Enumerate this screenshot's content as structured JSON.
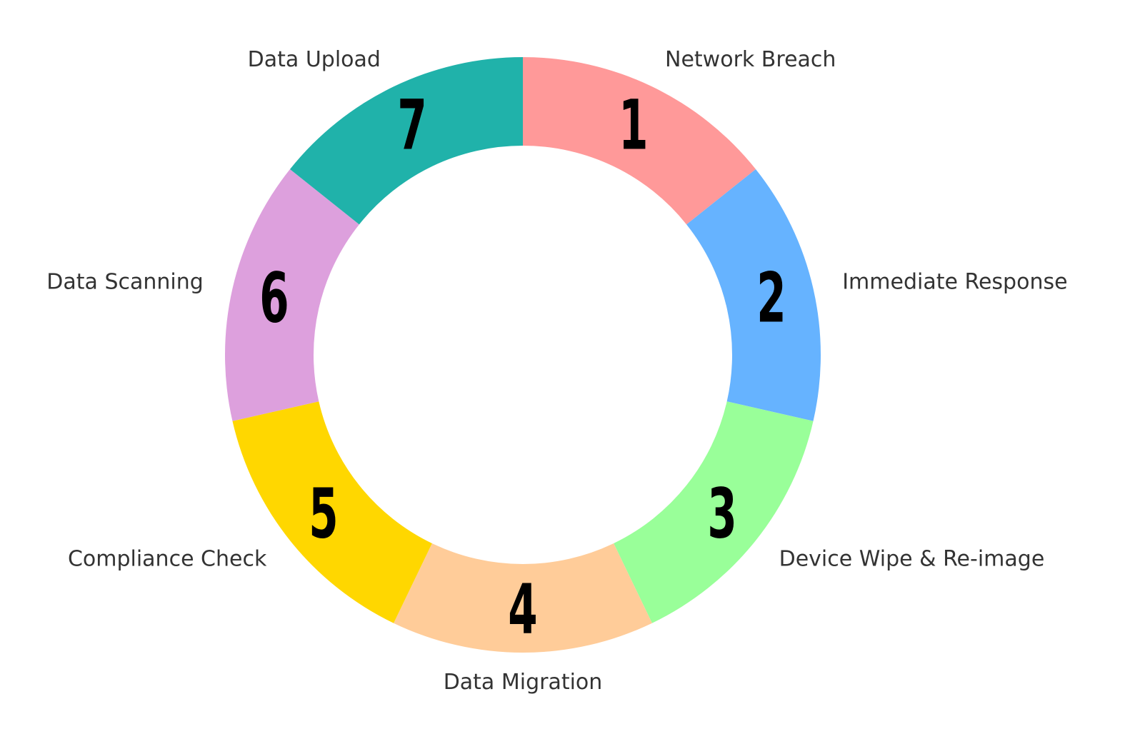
{
  "chart_data": {
    "type": "pie",
    "variant": "donut",
    "start": "top",
    "direction": "clockwise",
    "categories": [
      "Network Breach",
      "Immediate Response",
      "Device Wipe & Re-image",
      "Data Migration",
      "Compliance Check",
      "Data Scanning",
      "Data Upload"
    ],
    "values": [
      1,
      1,
      1,
      1,
      1,
      1,
      1
    ],
    "slice_labels": [
      "1",
      "2",
      "3",
      "4",
      "5",
      "6",
      "7"
    ],
    "colors": [
      "#FF9999",
      "#66B3FF",
      "#99FF99",
      "#FFCC99",
      "#FFD700",
      "#DDA0DD",
      "#20B2AA"
    ],
    "legend": "none"
  }
}
